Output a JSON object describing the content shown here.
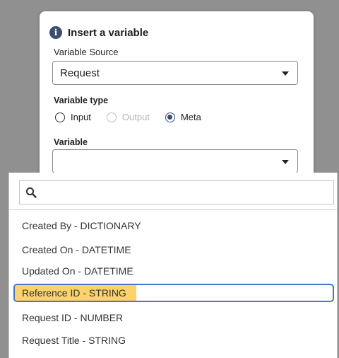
{
  "dialog": {
    "title": "Insert a variable",
    "icon": "info-icon",
    "variable_source": {
      "label": "Variable Source",
      "value": "Request"
    },
    "variable_type": {
      "label": "Variable type",
      "options": [
        {
          "label": "Input",
          "checked": false,
          "disabled": false
        },
        {
          "label": "Output",
          "checked": false,
          "disabled": true
        },
        {
          "label": "Meta",
          "checked": true,
          "disabled": false
        }
      ]
    },
    "variable": {
      "label": "Variable",
      "value": ""
    }
  },
  "dropdown": {
    "search_value": "",
    "options": [
      "Created By - DICTIONARY",
      "Created On - DATETIME",
      "Updated On - DATETIME",
      "Reference ID - STRING",
      "Request ID - NUMBER",
      "Request Title - STRING"
    ],
    "highlighted_index": 3
  },
  "colors": {
    "accent": "#3c4d6e",
    "highlight_fill": "#fbd36a",
    "focus_border": "#4a74c4",
    "overlay": "#909090"
  }
}
